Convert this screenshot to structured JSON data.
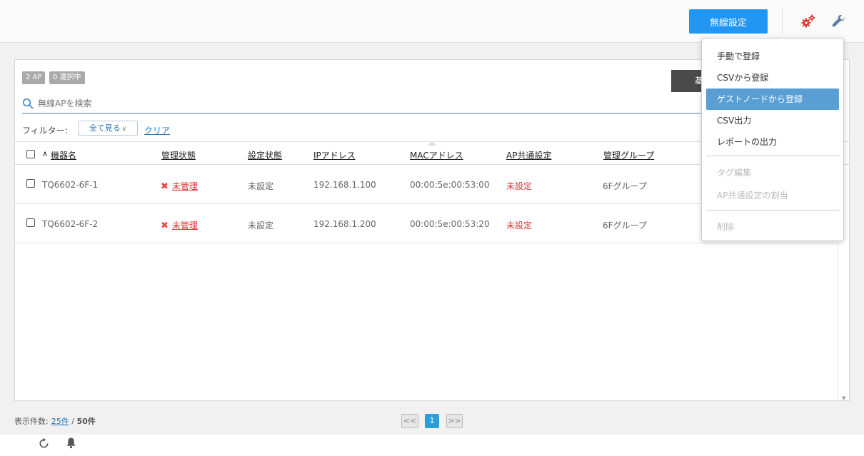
{
  "topbar": {
    "wireless_btn": "無線設定"
  },
  "panel": {
    "ap_count": "2 AP",
    "selected_count": "0 選択中",
    "dark_btn_label": "基",
    "search": {
      "placeholder": "無線APを検索"
    },
    "filter": {
      "label": "フィルター:",
      "value": "全て見る",
      "clear": "クリア"
    }
  },
  "table": {
    "headers": {
      "name": "機器名",
      "mgmt": "管理状態",
      "config": "設定状態",
      "ip": "IPアドレス",
      "mac": "MACアドレス",
      "common": "AP共通設定",
      "group": "管理グループ"
    },
    "rows": [
      {
        "name": "TQ6602-6F-1",
        "mgmt": "未管理",
        "config": "未設定",
        "ip": "192.168.1.100",
        "mac": "00:00:5e:00:53:00",
        "common": "未設定",
        "group": "6Fグループ"
      },
      {
        "name": "TQ6602-6F-2",
        "mgmt": "未管理",
        "config": "未設定",
        "ip": "192.168.1.200",
        "mac": "00:00:5e:00:53:20",
        "common": "未設定",
        "group": "6Fグループ"
      }
    ]
  },
  "pagination": {
    "label": "表示件数:",
    "per_page": "25件",
    "sep": "/",
    "total": "50件",
    "prev": "<<",
    "current": "1",
    "next": ">>"
  },
  "menu": {
    "items": [
      {
        "label": "手動で登録",
        "state": "normal"
      },
      {
        "label": "CSVから登録",
        "state": "normal"
      },
      {
        "label": "ゲストノードから登録",
        "state": "active"
      },
      {
        "label": "CSV出力",
        "state": "normal"
      },
      {
        "label": "レポートの出力",
        "state": "normal"
      },
      {
        "label": "タグ編集",
        "state": "disabled"
      },
      {
        "label": "AP共通設定の割当",
        "state": "disabled"
      },
      {
        "label": "削除",
        "state": "disabled"
      }
    ]
  },
  "colors": {
    "accent": "#2196f3",
    "menu_active": "#5a9fd4",
    "unmanaged": "#dd3333",
    "link": "#2a76b5"
  },
  "icons": [
    "gear-icon",
    "wrench-icon",
    "search-icon",
    "refresh-icon",
    "bell-icon",
    "x-icon"
  ]
}
